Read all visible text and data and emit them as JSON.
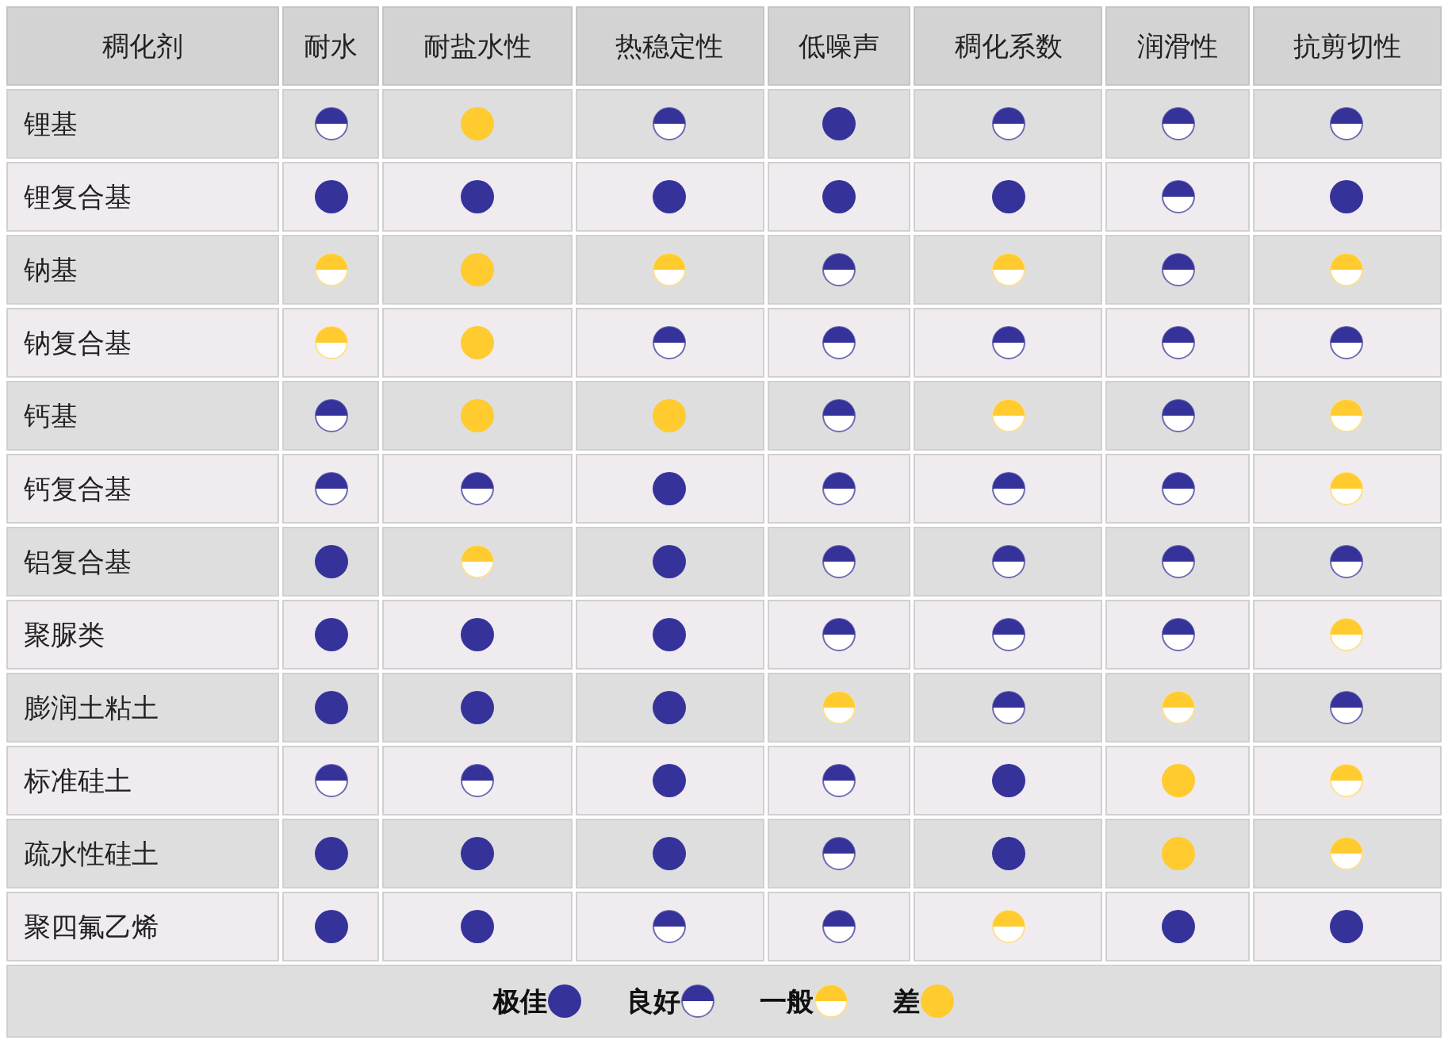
{
  "table": {
    "columns": [
      "稠化剂",
      "耐水",
      "耐盐水性",
      "热稳定性",
      "低噪声",
      "稠化系数",
      "润滑性",
      "抗剪切性"
    ],
    "rows": [
      {
        "name": "锂基",
        "ratings": [
          {
            "kind": "good"
          },
          {
            "kind": "poor"
          },
          {
            "kind": "good"
          },
          {
            "kind": "excellent"
          },
          {
            "kind": "good"
          },
          {
            "kind": "good"
          },
          {
            "kind": "good"
          }
        ]
      },
      {
        "name": "锂复合基",
        "ratings": [
          {
            "kind": "excellent"
          },
          {
            "kind": "excellent"
          },
          {
            "kind": "excellent"
          },
          {
            "kind": "excellent"
          },
          {
            "kind": "excellent"
          },
          {
            "kind": "good"
          },
          {
            "kind": "excellent"
          }
        ]
      },
      {
        "name": "钠基",
        "ratings": [
          {
            "kind": "fair"
          },
          {
            "kind": "poor"
          },
          {
            "kind": "fair"
          },
          {
            "kind": "good"
          },
          {
            "kind": "fair"
          },
          {
            "kind": "good"
          },
          {
            "kind": "fair"
          }
        ]
      },
      {
        "name": "钠复合基",
        "ratings": [
          {
            "kind": "fair"
          },
          {
            "kind": "poor"
          },
          {
            "kind": "good"
          },
          {
            "kind": "good"
          },
          {
            "kind": "good"
          },
          {
            "kind": "good"
          },
          {
            "kind": "good"
          }
        ]
      },
      {
        "name": "钙基",
        "ratings": [
          {
            "kind": "good"
          },
          {
            "kind": "poor"
          },
          {
            "kind": "poor"
          },
          {
            "kind": "good"
          },
          {
            "kind": "fair"
          },
          {
            "kind": "good"
          },
          {
            "kind": "fair"
          }
        ]
      },
      {
        "name": "钙复合基",
        "ratings": [
          {
            "kind": "good"
          },
          {
            "kind": "good"
          },
          {
            "kind": "excellent"
          },
          {
            "kind": "good"
          },
          {
            "kind": "good"
          },
          {
            "kind": "good"
          },
          {
            "kind": "fair"
          }
        ]
      },
      {
        "name": "铝复合基",
        "ratings": [
          {
            "kind": "excellent"
          },
          {
            "kind": "fair"
          },
          {
            "kind": "excellent"
          },
          {
            "kind": "good"
          },
          {
            "kind": "good"
          },
          {
            "kind": "good"
          },
          {
            "kind": "good"
          }
        ]
      },
      {
        "name": "聚脲类",
        "ratings": [
          {
            "kind": "excellent"
          },
          {
            "kind": "excellent"
          },
          {
            "kind": "excellent"
          },
          {
            "kind": "good"
          },
          {
            "kind": "good"
          },
          {
            "kind": "good"
          },
          {
            "kind": "fair"
          }
        ]
      },
      {
        "name": "膨润土粘土",
        "ratings": [
          {
            "kind": "excellent"
          },
          {
            "kind": "excellent"
          },
          {
            "kind": "excellent"
          },
          {
            "kind": "fair"
          },
          {
            "kind": "good"
          },
          {
            "kind": "fair"
          },
          {
            "kind": "good"
          }
        ]
      },
      {
        "name": "标准硅土",
        "ratings": [
          {
            "kind": "good"
          },
          {
            "kind": "good"
          },
          {
            "kind": "excellent"
          },
          {
            "kind": "good"
          },
          {
            "kind": "excellent"
          },
          {
            "kind": "poor"
          },
          {
            "kind": "fair"
          }
        ]
      },
      {
        "name": "疏水性硅土",
        "ratings": [
          {
            "kind": "excellent"
          },
          {
            "kind": "excellent"
          },
          {
            "kind": "excellent"
          },
          {
            "kind": "good"
          },
          {
            "kind": "excellent"
          },
          {
            "kind": "poor"
          },
          {
            "kind": "fair"
          }
        ]
      },
      {
        "name": "聚四氟乙烯",
        "ratings": [
          {
            "kind": "excellent"
          },
          {
            "kind": "excellent"
          },
          {
            "kind": "good"
          },
          {
            "kind": "good"
          },
          {
            "kind": "fair"
          },
          {
            "kind": "excellent"
          },
          {
            "kind": "excellent"
          }
        ]
      }
    ]
  },
  "legend": [
    {
      "label": "极佳",
      "kind": "excellent"
    },
    {
      "label": "良好",
      "kind": "good"
    },
    {
      "label": "一般",
      "kind": "fair"
    },
    {
      "label": "差",
      "kind": "poor"
    }
  ]
}
